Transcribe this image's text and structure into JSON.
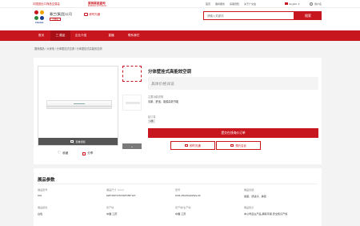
{
  "topbar": {
    "fair_name": "中国进出口商品交易会",
    "expo_title": "展商展品查询",
    "expo_subtitle": "Exhibitors & Products",
    "nav": [
      "首页",
      "展商服务",
      "来展须知",
      "关于广交会"
    ],
    "language": "English",
    "user_label": "用户名",
    "accent_color": "#c8161e"
  },
  "header": {
    "company_logo_name": "Chunlan",
    "company_name": "春兰(集团)公司",
    "company_badge": "品牌展",
    "chat_label": "即时沟通",
    "search_placeholder": "请输入关键词",
    "search_button": "搜索"
  },
  "mainnav": {
    "items": [
      "首页",
      "三 展品",
      "企业介绍",
      "直播",
      "联系我们"
    ],
    "active_index": 1
  },
  "breadcrumb": "展商展品 / 大家电 / 分体壁挂式空调 / 分体壁挂式高能效空调",
  "product": {
    "title": "分体壁挂式高能效空调",
    "price_placeholder": "具体价格详谈",
    "function_label": "主要功能说明",
    "function_value": "清新、舒适、能源高效节能",
    "moq_label": "起订量",
    "moq_value": "1件",
    "video_label": "查看视频",
    "favorite_label": "收藏",
    "share_label": "分享",
    "inquiry_button": "提交在线询价订单",
    "chat_button": "即时沟通",
    "meeting_button": "预约洽谈",
    "thumb_arrow": "⌄"
  },
  "params": {
    "title": "展品参数",
    "rows": [
      [
        {
          "key": "展品型号",
          "value": "001"
        },
        {
          "key": "展品尺寸（mm）",
          "value": "826*260*276/768*259*107"
        },
        {
          "key": "型号",
          "value": "KFR-25GW/AZ2Wa-03"
        },
        {
          "key": "展品性能",
          "value": "健康、舒适冷、静音"
        }
      ],
      [
        {
          "key": "展品颜色",
          "value": "白色"
        },
        {
          "key": "原产地",
          "value": "中国·江苏"
        },
        {
          "key": "原产地/生产地",
          "value": "中国·江苏"
        },
        {
          "key": "展品知识",
          "value": "本公司自主产品,拥有环保,安全知识产权"
        }
      ]
    ]
  }
}
